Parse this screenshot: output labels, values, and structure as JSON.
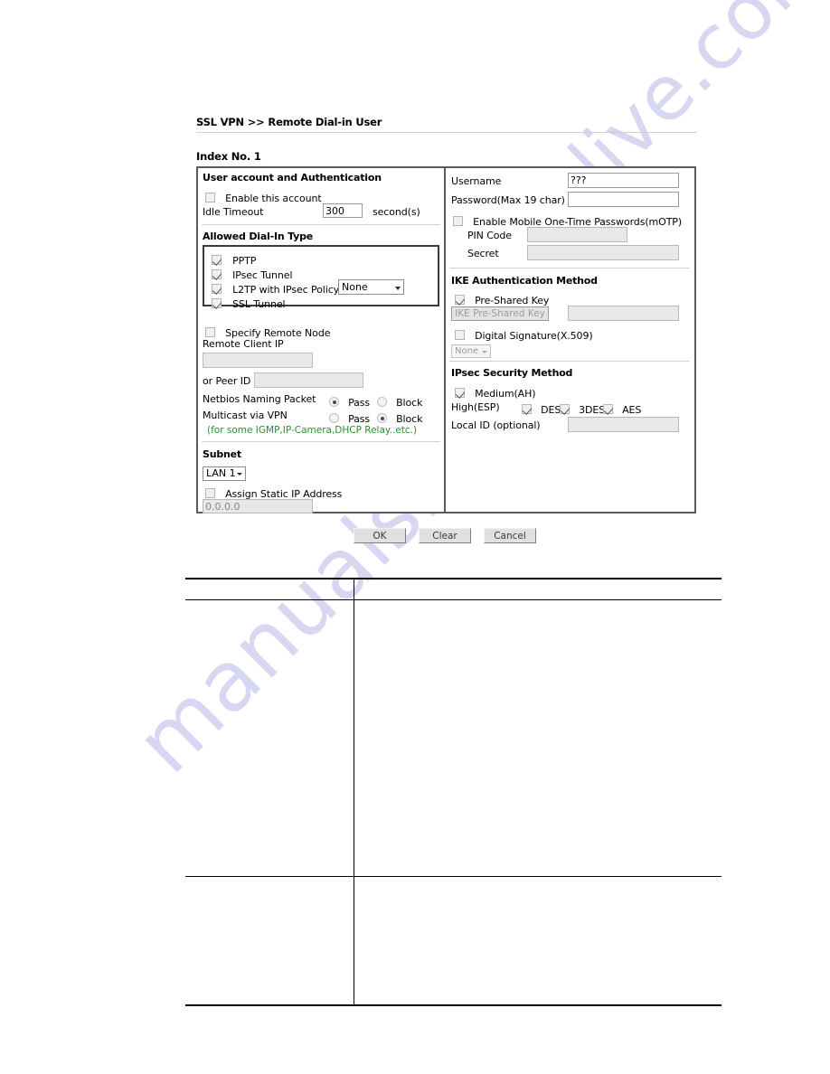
{
  "page": {
    "breadcrumb": "SSL VPN >> Remote Dial-in User",
    "index_title": "Index No. 1",
    "watermark_right": "alive.com",
    "watermark_left": "manualslive"
  },
  "left_panel": {
    "user_account": {
      "title": "User account and Authentication",
      "enable_account_label": "Enable this account",
      "enable_account_checked": false,
      "idle_timeout_label": "Idle Timeout",
      "idle_timeout_value": "300",
      "idle_timeout_unit": "second(s)"
    },
    "dial_in": {
      "title": "Allowed Dial-In Type",
      "items": [
        {
          "label": "PPTP",
          "checked": true
        },
        {
          "label": "IPsec Tunnel",
          "checked": true
        },
        {
          "label": "L2TP with IPsec Policy",
          "checked": true
        },
        {
          "label": "SSL Tunnel",
          "checked": true
        }
      ],
      "l2tp_policy_value": "None"
    },
    "remote_node": {
      "specify_label": "Specify Remote Node",
      "specify_checked": false,
      "remote_client_ip_label": "Remote Client IP",
      "remote_client_ip_value": "",
      "peer_id_label": "or Peer ID",
      "peer_id_value": "",
      "netbios_label": "Netbios Naming Packet",
      "netbios_pass": "Pass",
      "netbios_block": "Block",
      "netbios_selected": "Pass",
      "multicast_label": "Multicast via VPN",
      "multicast_pass": "Pass",
      "multicast_block": "Block",
      "multicast_selected": "Block",
      "note": "(for some IGMP,IP-Camera,DHCP Relay..etc.)"
    },
    "subnet": {
      "title": "Subnet",
      "value": "LAN 1",
      "assign_static_label": "Assign Static IP Address",
      "assign_static_checked": false,
      "static_ip_value": "0.0.0.0"
    }
  },
  "right_panel": {
    "credentials": {
      "username_label": "Username",
      "username_value": "???",
      "password_label": "Password(Max 19 char)",
      "password_value": "",
      "motp_label": "Enable Mobile One-Time Passwords(mOTP)",
      "motp_checked": false,
      "pin_code_label": "PIN Code",
      "pin_code_value": "",
      "secret_label": "Secret",
      "secret_value": ""
    },
    "ike_auth": {
      "title": "IKE Authentication Method",
      "psk_label": "Pre-Shared Key",
      "psk_checked": true,
      "psk_button_label": "IKE Pre-Shared Key",
      "psk_value": "",
      "digital_signature_label": "Digital Signature(X.509)",
      "digital_signature_checked": false,
      "digital_signature_value": "None"
    },
    "ipsec_security": {
      "title": "IPsec Security Method",
      "medium_label": "Medium(AH)",
      "medium_checked": true,
      "high_label": "High(ESP)",
      "ciphers": [
        {
          "label": "DES",
          "checked": true
        },
        {
          "label": "3DES",
          "checked": true
        },
        {
          "label": "AES",
          "checked": true
        }
      ],
      "local_id_label": "Local ID (optional)",
      "local_id_value": ""
    }
  },
  "actions": {
    "ok": "OK",
    "clear": "Clear",
    "cancel": "Cancel"
  },
  "description_table": {
    "header_left": "",
    "header_right": "",
    "row1_left": "",
    "row1_right": "",
    "row2_left": "",
    "row2_right": ""
  }
}
